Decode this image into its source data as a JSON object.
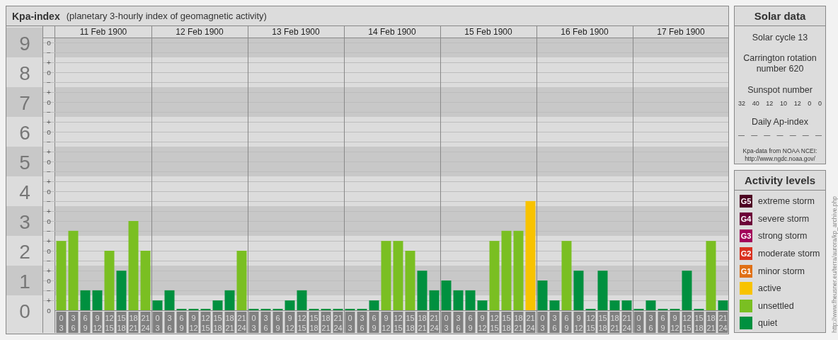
{
  "chart": {
    "title": "Kpa-index",
    "subtitle": "(planetary 3-hourly index of geomagnetic activity)",
    "days": [
      "11 Feb 1900",
      "12 Feb 1900",
      "13 Feb 1900",
      "14 Feb 1900",
      "15 Feb 1900",
      "16 Feb 1900",
      "17 Feb 1900"
    ],
    "minor_tick_labels": [
      "o",
      "−",
      "+",
      "o",
      "−",
      "+",
      "o",
      "−",
      "+",
      "o",
      "−",
      "+",
      "o",
      "−",
      "+",
      "o",
      "−",
      "+",
      "o",
      "−",
      "+",
      "o",
      "−",
      "+",
      "o",
      "−",
      "+",
      "o"
    ],
    "chart_data": {
      "type": "bar",
      "ylim": [
        0,
        9
      ],
      "grid": true,
      "yticks": [
        {
          "value": 0,
          "label": "0"
        },
        {
          "value": 1,
          "label": "1"
        },
        {
          "value": 2,
          "label": "2"
        },
        {
          "value": 3,
          "label": "3"
        },
        {
          "value": 4,
          "label": "4"
        },
        {
          "value": 5,
          "label": "5"
        },
        {
          "value": 6,
          "label": "6"
        },
        {
          "value": 7,
          "label": "7"
        },
        {
          "value": 8,
          "label": "8"
        },
        {
          "value": 9,
          "label": "9"
        }
      ],
      "categories": [
        "0\n3",
        "3\n6",
        "6\n9",
        "9\n12",
        "12\n15",
        "15\n18",
        "18\n21",
        "21\n24",
        "0\n3",
        "3\n6",
        "6\n9",
        "9\n12",
        "12\n15",
        "15\n18",
        "18\n21",
        "21\n24",
        "0\n3",
        "3\n6",
        "6\n9",
        "9\n12",
        "12\n15",
        "15\n18",
        "18\n21",
        "21\n24",
        "0\n3",
        "3\n6",
        "6\n9",
        "9\n12",
        "12\n15",
        "15\n18",
        "18\n21",
        "21\n24",
        "0\n3",
        "3\n6",
        "6\n9",
        "9\n12",
        "12\n15",
        "15\n18",
        "18\n21",
        "21\n24",
        "0\n3",
        "3\n6",
        "6\n9",
        "9\n12",
        "12\n15",
        "15\n18",
        "18\n21",
        "21\n24",
        "0\n3",
        "3\n6",
        "6\n9",
        "9\n12",
        "12\n15",
        "15\n18",
        "18\n21",
        "21\n24"
      ],
      "series": [
        {
          "values": [
            2.33,
            2.67,
            0.67,
            0.67,
            2,
            1.33,
            3,
            2,
            0.33,
            0.67,
            0,
            0,
            0,
            0.33,
            0.67,
            2,
            0,
            0,
            0,
            0.33,
            0.67,
            0,
            0,
            0,
            0,
            0,
            0.33,
            2.33,
            2.33,
            2,
            1.33,
            0.67,
            1,
            0.67,
            0.67,
            0.33,
            2.33,
            2.67,
            2.67,
            3.67,
            1,
            0.33,
            2.33,
            1.33,
            0,
            1.33,
            0.33,
            0.33,
            0,
            0.33,
            0,
            0,
            1.33,
            0,
            2.33,
            0.33
          ]
        }
      ]
    }
  },
  "solar": {
    "title": "Solar data",
    "cycle": "Solar cycle 13",
    "rotation": "Carrington rotation number 620",
    "sunspot_title": "Sunspot number",
    "sunspots": [
      "32",
      "40",
      "12",
      "10",
      "12",
      "0",
      "0"
    ],
    "ap_title": "Daily Ap-index",
    "ap": [
      "—",
      "—",
      "—",
      "—",
      "—",
      "—",
      "—"
    ],
    "source": "Kpa-data from NOAA NCEI:",
    "source_url": "http://www.ngdc.noaa.gov/"
  },
  "legend": {
    "title": "Activity levels",
    "items": [
      {
        "kind": "storm",
        "badge": "G5",
        "label": "extreme storm",
        "color": "#4d0022"
      },
      {
        "kind": "storm",
        "badge": "G4",
        "label": "severe storm",
        "color": "#6b0038"
      },
      {
        "kind": "storm",
        "badge": "G3",
        "label": "strong storm",
        "color": "#a3005a"
      },
      {
        "kind": "storm",
        "badge": "G2",
        "label": "moderate storm",
        "color": "#d9301f"
      },
      {
        "kind": "storm",
        "badge": "G1",
        "label": "minor storm",
        "color": "#e07016"
      },
      {
        "kind": "active",
        "label": "active",
        "color": "#f8c300"
      },
      {
        "kind": "unsettled",
        "label": "unsettled",
        "color": "#7abf22"
      },
      {
        "kind": "quiet",
        "label": "quiet",
        "color": "#00903f"
      }
    ]
  },
  "side_url": "http://www.fheusner.eu/terra/aurora/kp_archive.php"
}
